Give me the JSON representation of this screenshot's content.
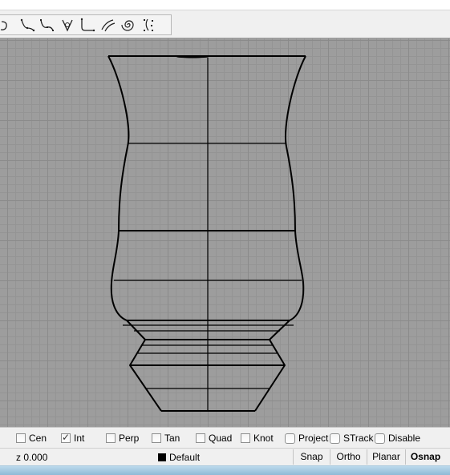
{
  "toolbar": {
    "tools": [
      {
        "icon": "arc-curve-icon"
      },
      {
        "icon": "interpolate-curve-icon"
      },
      {
        "icon": "control-point-curve-icon"
      },
      {
        "icon": "sketch-curve-icon"
      },
      {
        "icon": "fillet-curve-icon"
      },
      {
        "icon": "offset-curve-icon"
      },
      {
        "icon": "spiral-icon"
      },
      {
        "icon": "curve-points-icon"
      }
    ]
  },
  "osnap": {
    "items": [
      {
        "label": "Cen",
        "checked": false
      },
      {
        "label": "Int",
        "checked": true
      },
      {
        "label": "Perp",
        "checked": false
      },
      {
        "label": "Tan",
        "checked": false
      },
      {
        "label": "Quad",
        "checked": false
      },
      {
        "label": "Knot",
        "checked": false
      },
      {
        "label": "Project",
        "checked": false
      },
      {
        "label": "STrack",
        "checked": false
      },
      {
        "label": "Disable",
        "checked": false
      }
    ]
  },
  "status": {
    "coordinate": "z 0.000",
    "layer": "Default",
    "layer_color": "#000000",
    "panes": [
      "Snap",
      "Ortho",
      "Planar",
      "Osnap"
    ]
  },
  "colors": {
    "viewport_bg": "#9d9d9d",
    "curve": "#000000",
    "taskbar": "#a6cbe3"
  }
}
